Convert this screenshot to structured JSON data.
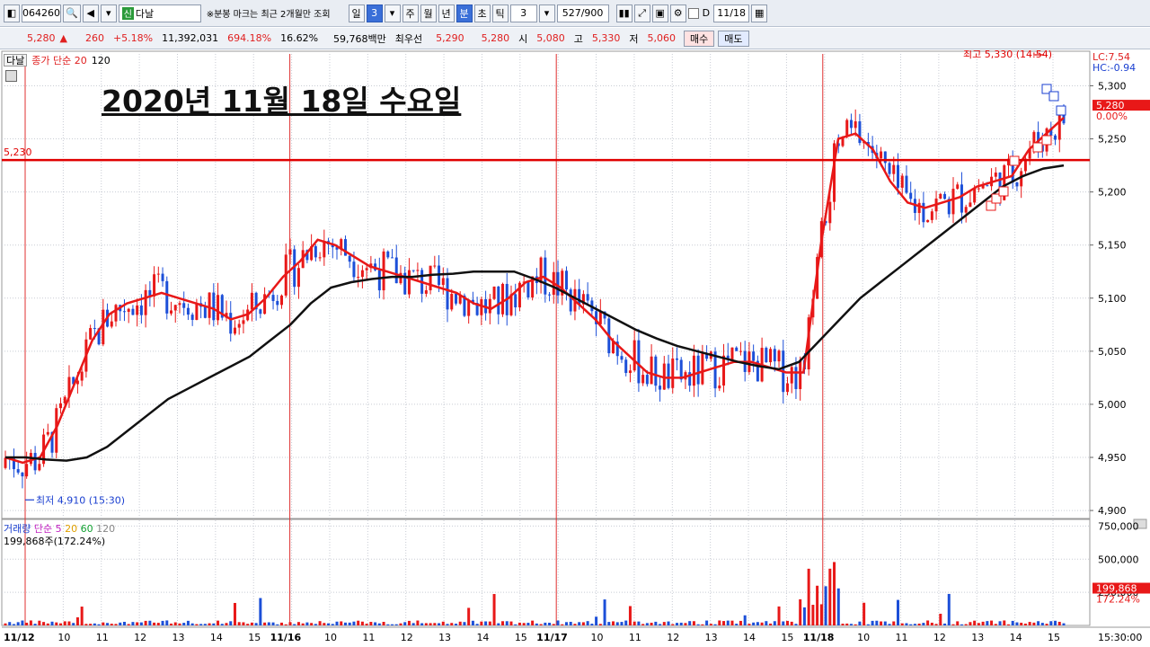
{
  "toolbar": {
    "code": "064260",
    "credit_tag": "신",
    "name": "다날",
    "notice": "※분봉 마크는 최근 2개월만 조회",
    "period_buttons": [
      "일",
      "3",
      "주",
      "월",
      "년",
      "分",
      "초",
      "틱"
    ],
    "period_labels": {
      "day": "일",
      "n": "3",
      "week": "주",
      "month": "월",
      "year": "년",
      "minute": "분",
      "second": "초",
      "tick": "틱"
    },
    "interval_value": "3",
    "count_value": "527/900",
    "date_check_label": "D",
    "date_value": "11/18"
  },
  "quote": {
    "price": "5,280",
    "change_arrow": "▲",
    "change": "260",
    "change_pct": "+5.18%",
    "volume": "11,392,031",
    "volume_ratio": "694.18%",
    "turnover": "16.62%",
    "amount": "59,768백만",
    "best_ask_label": "최우선",
    "best_ask": "5,290",
    "best_bid": "5,280",
    "open_label": "시",
    "open": "5,080",
    "high_label": "고",
    "high": "5,330",
    "low_label": "저",
    "low": "5,060",
    "buy_label": "매수",
    "sell_label": "매도"
  },
  "legend": {
    "name": "다날",
    "line_label": "종가 단순 20",
    "line_label2": "120",
    "volume_label": "거래량",
    "vol_ma": [
      "단순 5",
      "20",
      "60",
      "120"
    ],
    "volume_value": "199,868주(172.24%)",
    "lc": "LC:7.54",
    "hc": "HC:-0.94"
  },
  "overlay_title": "2020년 11월 18일 수요일",
  "annotations": {
    "high_text": "최고 5,330 (14:54)",
    "low_text": "최저 4,910 (15:30)",
    "hline_label": "5,230",
    "last_price_tag": "5,280",
    "last_pct_tag": "0.00%",
    "vol_tag": "199,868",
    "vol_pct_tag": "172.24%"
  },
  "chart_data": {
    "type": "candlestick",
    "price_axis": [
      "5,300",
      "5,250",
      "5,200",
      "5,150",
      "5,100",
      "5,050",
      "5,000",
      "4,950",
      "4,900"
    ],
    "price_range": [
      4895,
      5330
    ],
    "volume_axis": [
      "750,000",
      "500,000",
      "250,000"
    ],
    "volume_range": [
      0,
      800000
    ],
    "x_labels": [
      "11/12",
      "10",
      "11",
      "12",
      "13",
      "14",
      "15",
      "11/16",
      "10",
      "11",
      "12",
      "13",
      "14",
      "15",
      "11/17",
      "10",
      "11",
      "12",
      "13",
      "14",
      "15",
      "11/18",
      "10",
      "11",
      "12",
      "13",
      "14",
      "15"
    ],
    "session_dividers": [
      "11/12",
      "11/16",
      "11/17",
      "11/18"
    ],
    "horizontal_line": 5230,
    "time_axis_right": "15:30:00",
    "ma20": [
      4950,
      4945,
      4950,
      4980,
      5020,
      5060,
      5085,
      5095,
      5100,
      5105,
      5100,
      5095,
      5090,
      5080,
      5085,
      5100,
      5120,
      5135,
      5155,
      5150,
      5140,
      5130,
      5125,
      5120,
      5115,
      5110,
      5105,
      5095,
      5090,
      5100,
      5115,
      5120,
      5110,
      5095,
      5080,
      5060,
      5045,
      5030,
      5025,
      5025,
      5030,
      5035,
      5040,
      5040,
      5035,
      5030,
      5030,
      5150,
      5250,
      5255,
      5240,
      5210,
      5190,
      5185,
      5190,
      5195,
      5205,
      5210,
      5215,
      5240,
      5255,
      5270
    ],
    "ma120": [
      4950,
      4950,
      4948,
      4947,
      4950,
      4960,
      4975,
      4990,
      5005,
      5015,
      5025,
      5035,
      5045,
      5060,
      5075,
      5095,
      5110,
      5115,
      5118,
      5120,
      5120,
      5122,
      5123,
      5125,
      5125,
      5125,
      5118,
      5110,
      5100,
      5090,
      5080,
      5070,
      5062,
      5055,
      5050,
      5045,
      5040,
      5036,
      5033,
      5040,
      5060,
      5080,
      5100,
      5115,
      5130,
      5145,
      5160,
      5175,
      5190,
      5205,
      5215,
      5222,
      5225
    ]
  }
}
